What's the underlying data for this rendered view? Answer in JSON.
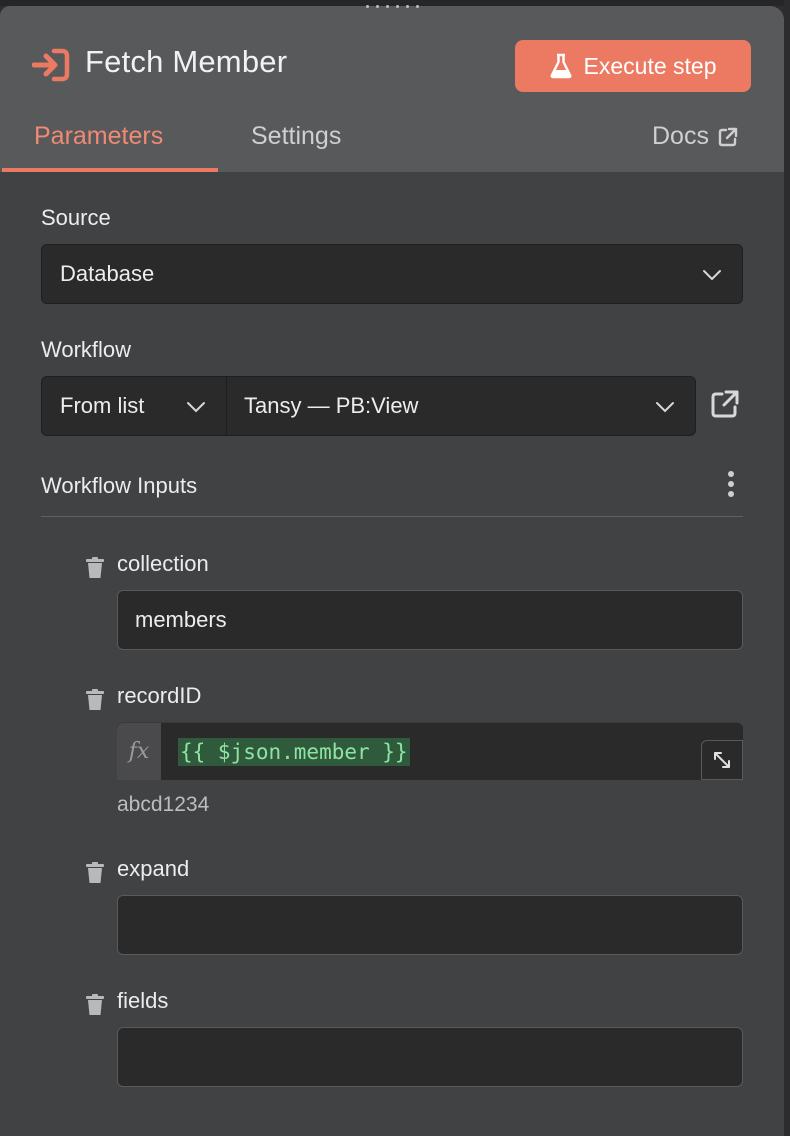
{
  "node": {
    "title": "Fetch Member",
    "icon": "sign-in-arrow-icon",
    "execute_label": "Execute step"
  },
  "tabs": {
    "parameters": "Parameters",
    "settings": "Settings",
    "docs": "Docs"
  },
  "source": {
    "label": "Source",
    "value": "Database"
  },
  "workflow": {
    "label": "Workflow",
    "mode": "From list",
    "value": "Tansy — PB:View"
  },
  "workflow_inputs": {
    "title": "Workflow Inputs",
    "params": [
      {
        "name": "collection",
        "value": "members"
      },
      {
        "name": "recordID",
        "expression": "{{ $json.member }}",
        "fx": "fx",
        "preview": "abcd1234"
      },
      {
        "name": "expand",
        "value": ""
      },
      {
        "name": "fields",
        "value": ""
      }
    ]
  },
  "colors": {
    "accent": "#ec7a63",
    "panel": "#414244",
    "header": "#58595b",
    "field": "#2a2a2b",
    "expression_green": "#8fe3a6"
  }
}
